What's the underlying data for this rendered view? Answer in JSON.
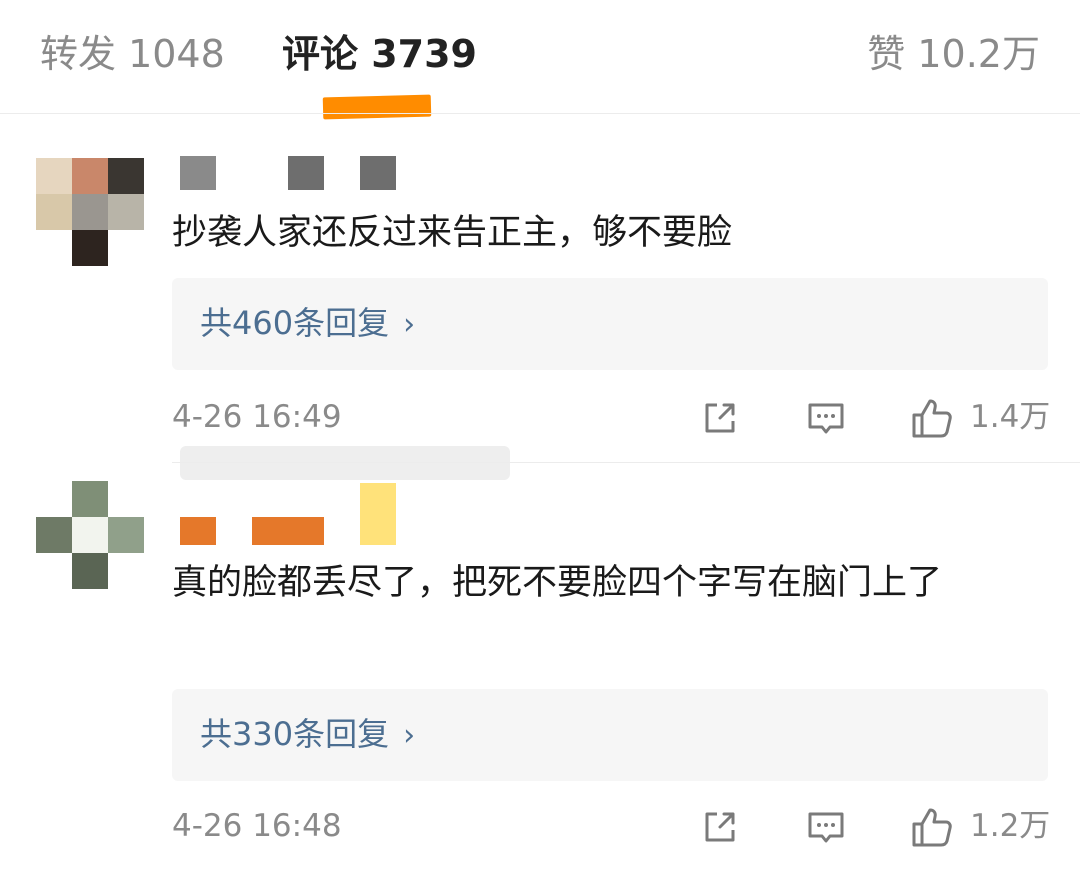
{
  "tabs": {
    "repost": "转发 1048",
    "comments": "评论 3739",
    "likes": "赞 10.2万",
    "accent_color": "#ff8c00"
  },
  "comments": [
    {
      "text": "抄袭人家还反过来告正主，够不要脸",
      "replies_label": "共460条回复",
      "timestamp": "4-26 16:49",
      "like_count": "1.4万",
      "avatar_colors": [
        "#e6d6bf",
        "#c9876a",
        "#3a3631",
        "#d8c8a9",
        "#9a9690",
        "#b8b4a8",
        "#ffffff",
        "#2d241f",
        "#ffffff"
      ],
      "name_colors": [
        "#8a8a8a",
        "#6e6e6e",
        "#6e6e6e"
      ]
    },
    {
      "text": "真的脸都丢尽了，把死不要脸四个字写在脑门上了",
      "replies_label": "共330条回复",
      "timestamp": "4-26 16:48",
      "like_count": "1.2万",
      "avatar_colors": [
        "#ffffff",
        "#7f8f77",
        "#ffffff",
        "#6e7a66",
        "#f2f4ee",
        "#90a08a",
        "#ffffff",
        "#5a6554",
        "#ffffff"
      ],
      "name_colors": [
        "#e5782a",
        "#e5782a",
        "#ffe27a"
      ]
    }
  ],
  "icons": {
    "share": "share-icon",
    "reply": "comment-icon",
    "like": "thumbs-up-icon",
    "chevron": "chevron-right-icon"
  }
}
